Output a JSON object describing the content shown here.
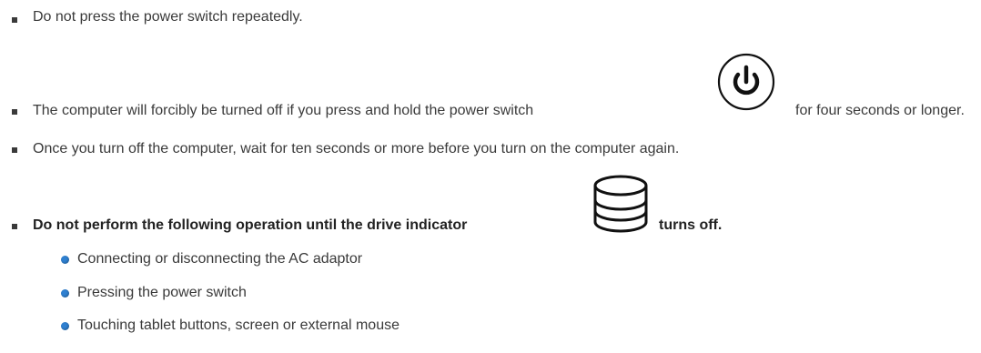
{
  "items": [
    {
      "text": "Do not press the power switch repeatedly."
    },
    {
      "text_before": "The computer will forcibly be turned off if you press and hold the power switch",
      "text_after": "for four seconds or longer.",
      "icon": "power-icon"
    },
    {
      "text": "Once you turn off the computer, wait for ten seconds or more before you turn on the computer again."
    },
    {
      "text_before": "Do not perform the following operation until the drive indicator",
      "text_after": "turns off.",
      "icon": "drive-indicator-icon"
    }
  ],
  "sub_items": [
    {
      "text": "Connecting or disconnecting the AC adaptor"
    },
    {
      "text": "Pressing the power switch"
    },
    {
      "text": "Touching tablet buttons, screen or external mouse"
    }
  ],
  "colors": {
    "text": "#3a3a3a",
    "bullet": "#3a3a3a",
    "sub_bullet": "#2f80d1"
  }
}
